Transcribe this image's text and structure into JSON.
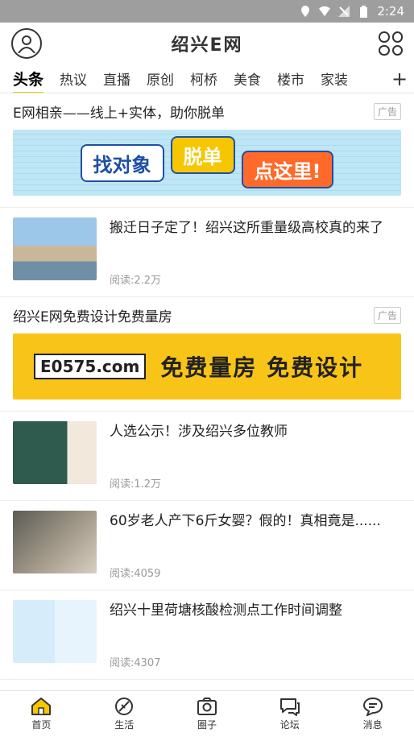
{
  "status": {
    "time": "2:24"
  },
  "header": {
    "logo": "绍兴E网"
  },
  "tabs": [
    "头条",
    "热议",
    "直播",
    "原创",
    "柯桥",
    "美食",
    "楼市",
    "家装"
  ],
  "tab_plus": "+",
  "ads": [
    {
      "title": "E网相亲——线上+实体，助你脱单",
      "tag": "广告",
      "banner_words": [
        "找对象",
        "脱单",
        "点这里!"
      ]
    },
    {
      "title": "绍兴E网免费设计免费量房",
      "tag": "广告",
      "banner_logo": "E0575.com",
      "banner_text": "免费量房 免费设计"
    }
  ],
  "news": [
    {
      "title": "搬迁日子定了！绍兴这所重量级高校真的来了",
      "meta": "阅读:2.2万"
    },
    {
      "title": "人选公示！涉及绍兴多位教师",
      "meta": "阅读:1.2万"
    },
    {
      "title": "60岁老人产下6斤女婴？假的！真相竟是......",
      "meta": "阅读:4059"
    },
    {
      "title": "绍兴十里荷塘核酸检测点工作时间调整",
      "meta": "阅读:4307"
    }
  ],
  "bottom_nav": [
    {
      "label": "首页",
      "icon": "home-icon",
      "active": true
    },
    {
      "label": "生活",
      "icon": "leaf-icon"
    },
    {
      "label": "圈子",
      "icon": "camera-icon"
    },
    {
      "label": "论坛",
      "icon": "chat-icon"
    },
    {
      "label": "消息",
      "icon": "message-icon"
    }
  ],
  "colors": {
    "accent": "#f6c700",
    "status_bar": "#9e9e9e"
  }
}
